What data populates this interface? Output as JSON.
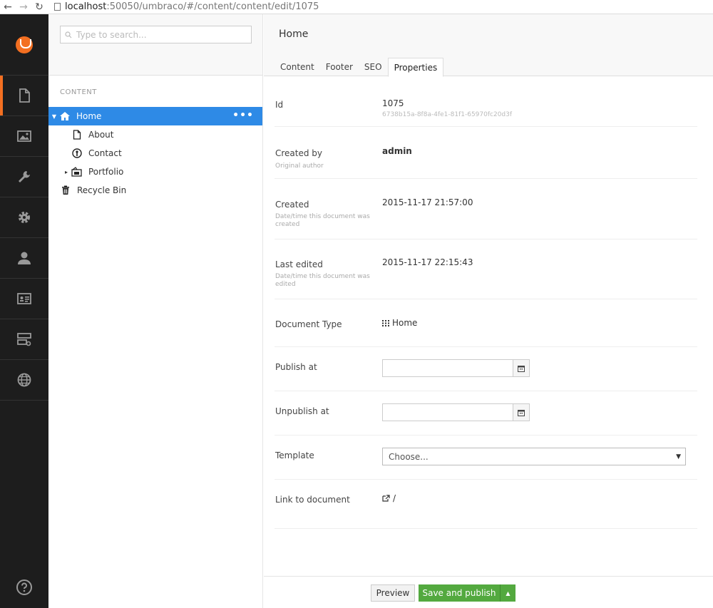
{
  "browser": {
    "url_host": "localhost",
    "url_rest": ":50050/umbraco/#/content/content/edit/1075"
  },
  "search": {
    "placeholder": "Type to search..."
  },
  "tree": {
    "section_label": "CONTENT",
    "items": [
      {
        "label": "Home",
        "icon": "home-icon"
      },
      {
        "label": "About",
        "icon": "document-icon"
      },
      {
        "label": "Contact",
        "icon": "contact-icon"
      },
      {
        "label": "Portfolio",
        "icon": "portfolio-icon"
      },
      {
        "label": "Recycle Bin",
        "icon": "trash-icon"
      }
    ],
    "more_glyph": "•••"
  },
  "editor": {
    "page_name": "Home",
    "tabs": [
      "Content",
      "Footer",
      "SEO",
      "Properties"
    ],
    "properties": {
      "id": {
        "label": "Id",
        "value": "1075",
        "guid": "6738b15a-8f8a-4fe1-81f1-65970fc20d3f"
      },
      "created_by": {
        "label": "Created by",
        "desc": "Original author",
        "value": "admin"
      },
      "created": {
        "label": "Created",
        "desc": "Date/time this document was created",
        "value": "2015-11-17 21:57:00"
      },
      "last_edited": {
        "label": "Last edited",
        "desc": "Date/time this document was edited",
        "value": "2015-11-17 22:15:43"
      },
      "document_type": {
        "label": "Document Type",
        "value": "Home"
      },
      "publish_at": {
        "label": "Publish at",
        "value": ""
      },
      "unpublish_at": {
        "label": "Unpublish at",
        "value": ""
      },
      "template": {
        "label": "Template",
        "value": "Choose..."
      },
      "link": {
        "label": "Link to document",
        "value": "/"
      }
    }
  },
  "footer": {
    "preview_label": "Preview",
    "save_label": "Save and publish"
  },
  "colors": {
    "accent": "#f36f21",
    "selected": "#2e8ae6",
    "save": "#53a93f",
    "appbar": "#1d1d1d"
  }
}
